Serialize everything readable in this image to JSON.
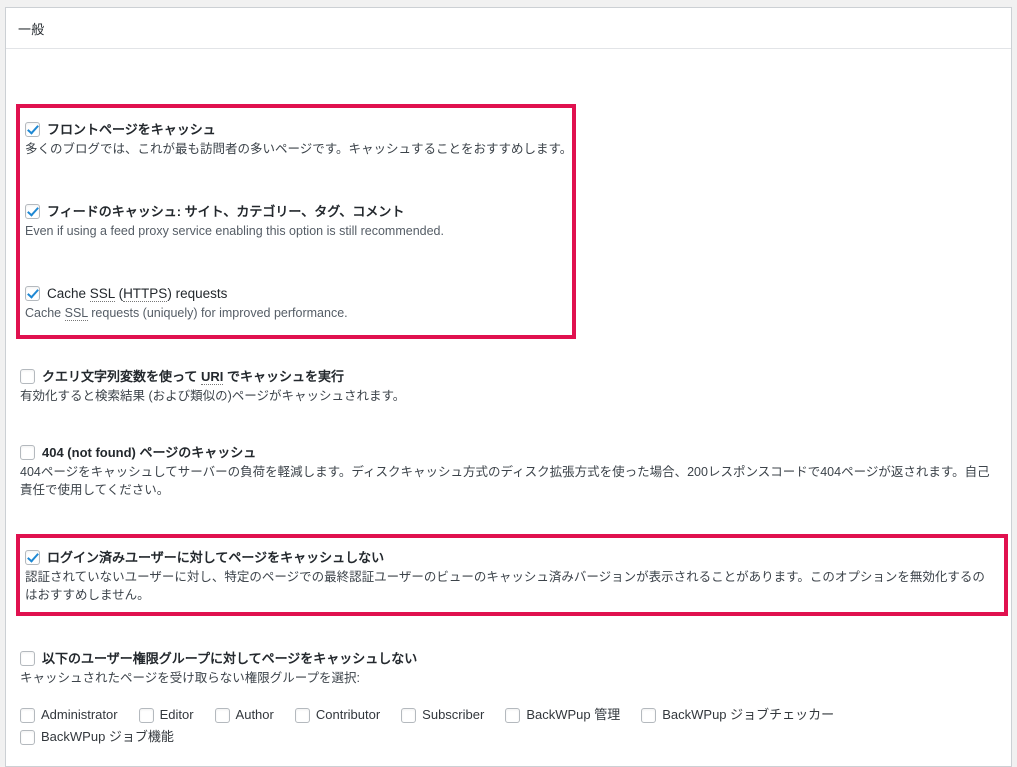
{
  "panel": {
    "header_title": "一般"
  },
  "colors": {
    "highlight_border": "#e0114f",
    "checkbox_check": "#1e88d3",
    "panel_border": "#ccd0d4",
    "page_background": "#f1f1f1"
  },
  "options": [
    {
      "id": "cache-front-page",
      "label": "フロントページをキャッシュ",
      "checked": true,
      "description": "多くのブログでは、これが最も訪問者の多いページです。キャッシュすることをおすすめします。",
      "highlighted": true
    },
    {
      "id": "cache-feeds",
      "label": "フィードのキャッシュ: サイト、カテゴリー、タグ、コメント",
      "checked": true,
      "description": "Even if using a feed proxy service enabling this option is still recommended.",
      "highlighted": true
    },
    {
      "id": "cache-ssl",
      "label_parts": {
        "pre": "Cache ",
        "abbr1": "SSL",
        "mid": " (",
        "abbr2": "HTTPS",
        "post": ") requests"
      },
      "label": "Cache SSL (HTTPS) requests",
      "checked": true,
      "description_parts": {
        "pre": "Cache ",
        "abbr1": "SSL",
        "post": " requests (uniquely) for improved performance."
      },
      "description": "Cache SSL requests (uniquely) for improved performance.",
      "highlighted": true
    },
    {
      "id": "cache-query-string",
      "label_parts": {
        "pre": "クエリ文字列変数を使って ",
        "abbr1": "URI",
        "post": " でキャッシュを実行"
      },
      "label": "クエリ文字列変数を使って URI でキャッシュを実行",
      "checked": false,
      "description": "有効化すると検索結果 (および類似の)ページがキャッシュされます。",
      "highlighted": false
    },
    {
      "id": "cache-404",
      "label": "404 (not found) ページのキャッシュ",
      "checked": false,
      "description": "404ページをキャッシュしてサーバーの負荷を軽減します。ディスクキャッシュ方式のディスク拡張方式を使った場合、200レスポンスコードで404ページが返されます。自己責任で使用してください。",
      "highlighted": false
    },
    {
      "id": "dont-cache-logged-in",
      "label": "ログイン済みユーザーに対してページをキャッシュしない",
      "checked": true,
      "description": "認証されていないユーザーに対し、特定のページでの最終認証ユーザーのビューのキャッシュ済みバージョンが表示されることがあります。このオプションを無効化するのはおすすめしません。",
      "highlighted": true
    },
    {
      "id": "dont-cache-roles",
      "label": "以下のユーザー権限グループに対してページをキャッシュしない",
      "checked": false,
      "description": "キャッシュされたページを受け取らない権限グループを選択:",
      "highlighted": false
    }
  ],
  "roles": [
    {
      "id": "administrator",
      "label": "Administrator",
      "checked": false
    },
    {
      "id": "editor",
      "label": "Editor",
      "checked": false
    },
    {
      "id": "author",
      "label": "Author",
      "checked": false
    },
    {
      "id": "contributor",
      "label": "Contributor",
      "checked": false
    },
    {
      "id": "subscriber",
      "label": "Subscriber",
      "checked": false
    },
    {
      "id": "backwpup-admin",
      "label": "BackWPup 管理",
      "checked": false
    },
    {
      "id": "backwpup-job-checker",
      "label": "BackWPup ジョブチェッカー",
      "checked": false
    },
    {
      "id": "backwpup-job-function",
      "label": "BackWPup ジョブ機能",
      "checked": false
    }
  ]
}
